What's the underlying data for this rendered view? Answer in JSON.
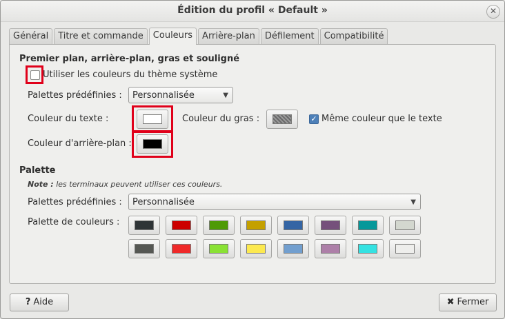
{
  "window": {
    "title": "Édition du profil « Default »",
    "close_glyph": "✕"
  },
  "tabs": [
    {
      "label": "Général"
    },
    {
      "label": "Titre et commande"
    },
    {
      "label": "Couleurs"
    },
    {
      "label": "Arrière-plan"
    },
    {
      "label": "Défilement"
    },
    {
      "label": "Compatibilité"
    }
  ],
  "active_tab": "Couleurs",
  "fg_section": {
    "heading": "Premier plan, arrière-plan, gras et souligné",
    "use_theme_label": "Utiliser les couleurs du thème système",
    "use_theme_checked": false,
    "builtin_label": "Palettes prédéfinies :",
    "builtin_value": "Personnalisée",
    "text_color_label": "Couleur du texte :",
    "text_color": "#ffffff",
    "bold_color_label": "Couleur du gras :",
    "same_as_text_label": "Même couleur que le texte",
    "same_as_text_checked": true,
    "bg_color_label": "Couleur d'arrière-plan :",
    "bg_color": "#000000"
  },
  "palette_section": {
    "heading": "Palette",
    "note_prefix": "Note :",
    "note_text": "les terminaux peuvent utiliser ces couleurs.",
    "builtin_label": "Palettes prédéfinies :",
    "builtin_value": "Personnalisée",
    "colors_label": "Palette de couleurs :",
    "row1": [
      "#2e3436",
      "#cc0000",
      "#4e9a06",
      "#c4a000",
      "#3465a4",
      "#75507b",
      "#06989a",
      "#d3d7cf"
    ],
    "row2": [
      "#555753",
      "#ef2929",
      "#8ae234",
      "#fce94f",
      "#729fcf",
      "#ad7fa8",
      "#34e2e2",
      "#eeeeec"
    ]
  },
  "footer": {
    "help_label": "Aide",
    "help_icon": "?",
    "close_label": "Fermer",
    "close_icon": "✖"
  },
  "highlight_color": "#e0001a"
}
